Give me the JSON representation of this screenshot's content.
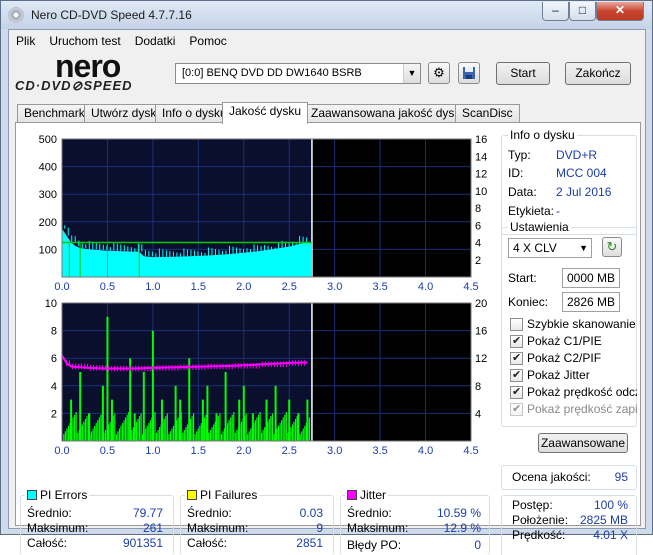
{
  "window": {
    "title": "Nero CD-DVD Speed 4.7.7.16",
    "min": "–",
    "max": "□",
    "close": "✕"
  },
  "menu": [
    "Plik",
    "Uruchom test",
    "Dodatki",
    "Pomoc"
  ],
  "logo": {
    "top": "nero",
    "bottom": "CD·DVD⊘SPEED"
  },
  "drive": {
    "value": "[0:0]   BENQ DVD DD DW1640 BSRB",
    "arrow": "▼"
  },
  "buttons": {
    "start": "Start",
    "stop": "Zakończ",
    "advanced": "Zaawansowane"
  },
  "tabs": [
    "Benchmark",
    "Utwórz dysk",
    "Info o dysku",
    "Jakość dysku",
    "Zaawansowana jakość dysku",
    "ScanDisc"
  ],
  "info": {
    "title": "Info o dysku",
    "type_label": "Typ:",
    "type": "DVD+R",
    "id_label": "ID:",
    "id": "MCC 004",
    "date_label": "Data:",
    "date": "2 Jul 2016",
    "label_label": "Etykieta:",
    "label": "-"
  },
  "settings": {
    "title": "Ustawienia",
    "speed": "4 X CLV",
    "start_label": "Start:",
    "start": "0000 MB",
    "end_label": "Koniec:",
    "end": "2826 MB",
    "checks": [
      {
        "label": "Szybkie skanowanie",
        "on": false,
        "dim": false
      },
      {
        "label": "Pokaż C1/PIE",
        "on": true,
        "dim": false
      },
      {
        "label": "Pokaż C2/PIF",
        "on": true,
        "dim": false
      },
      {
        "label": "Pokaż Jitter",
        "on": true,
        "dim": false
      },
      {
        "label": "Pokaż prędkość odczytu",
        "on": true,
        "dim": false
      },
      {
        "label": "Pokaż prędkość zapisu",
        "on": true,
        "dim": true
      }
    ]
  },
  "quality": {
    "label": "Ocena jakości:",
    "value": "95"
  },
  "progress": {
    "postep_label": "Postęp:",
    "postep": "100 %",
    "polozenie_label": "Położenie:",
    "polozenie": "2825 MB",
    "predkosc_label": "Prędkość:",
    "predkosc": "4.01 X"
  },
  "pi_errors": {
    "title": "PI Errors",
    "avg_label": "Średnio:",
    "avg": "79.77",
    "max_label": "Maksimum:",
    "max": "261",
    "total_label": "Całość:",
    "total": "901351",
    "color": "#00ffff"
  },
  "pi_failures": {
    "title": "PI Failures",
    "avg_label": "Średnio:",
    "avg": "0.03",
    "max_label": "Maksimum:",
    "max": "9",
    "total_label": "Całość:",
    "total": "2851",
    "color": "#ffff00"
  },
  "jitter": {
    "title": "Jitter",
    "avg_label": "Średnio:",
    "avg": "10.59 %",
    "max_label": "Maksimum:",
    "max": "12.9 %",
    "po_label": "Błędy PO:",
    "po": "0",
    "color": "#ff00ff"
  },
  "chart_data": [
    {
      "type": "area",
      "series": [
        {
          "name": "PI Errors",
          "color": "#00ffff",
          "x": [
            0.0,
            0.05,
            0.1,
            0.15,
            0.2,
            0.3,
            0.4,
            0.5,
            0.6,
            0.7,
            0.8,
            0.85,
            0.9,
            1.0,
            1.2,
            1.4,
            1.6,
            1.8,
            2.0,
            2.2,
            2.4,
            2.5,
            2.6,
            2.7,
            2.75
          ],
          "values": [
            175,
            150,
            125,
            112,
            105,
            100,
            98,
            95,
            94,
            93,
            92,
            92,
            75,
            72,
            73,
            75,
            78,
            82,
            88,
            95,
            105,
            110,
            118,
            128,
            120
          ]
        },
        {
          "name": "Read speed",
          "color": "#00cc00",
          "x": [
            0.0,
            0.5,
            1.0,
            1.5,
            2.0,
            2.5,
            2.75
          ],
          "values": [
            4,
            4,
            4,
            4,
            4,
            4,
            4
          ]
        }
      ],
      "xlim": [
        0,
        4.5
      ],
      "ylim": [
        0,
        500
      ],
      "y2lim": [
        0,
        16
      ],
      "xticks": [
        "0.0",
        "0.5",
        "1.0",
        "1.5",
        "2.0",
        "2.5",
        "3.0",
        "3.5",
        "4.0",
        "4.5"
      ],
      "yticks": [
        "100",
        "200",
        "300",
        "400",
        "500"
      ],
      "y2ticks": [
        "2",
        "4",
        "6",
        "8",
        "10",
        "12",
        "14",
        "16"
      ],
      "grid": true
    },
    {
      "type": "bar",
      "series": [
        {
          "name": "PI Failures",
          "color": "#00ff00",
          "x": [
            0.1,
            0.2,
            0.3,
            0.45,
            0.5,
            0.55,
            0.75,
            0.8,
            0.9,
            1.0,
            1.1,
            1.25,
            1.3,
            1.4,
            1.55,
            1.6,
            1.7,
            1.8,
            1.95,
            2.0,
            2.1,
            2.25,
            2.35,
            2.5,
            2.6,
            2.7
          ],
          "values": [
            3,
            5,
            2,
            4,
            9,
            3,
            6,
            2,
            5,
            8,
            3,
            4,
            3,
            6,
            3,
            4,
            2,
            5,
            3,
            4,
            2,
            3,
            4,
            3,
            2,
            3
          ]
        },
        {
          "name": "Jitter",
          "color": "#ff00ff",
          "x": [
            0.0,
            0.05,
            0.1,
            0.3,
            0.5,
            0.8,
            1.0,
            1.3,
            1.6,
            1.9,
            2.2,
            2.5,
            2.7
          ],
          "values": [
            12.4,
            11.3,
            10.8,
            10.6,
            10.5,
            10.5,
            10.6,
            10.7,
            10.8,
            10.9,
            11.1,
            11.3,
            11.4
          ]
        }
      ],
      "xlim": [
        0,
        4.5
      ],
      "ylim": [
        0,
        10
      ],
      "y2lim": [
        0,
        20
      ],
      "xticks": [
        "0.0",
        "0.5",
        "1.0",
        "1.5",
        "2.0",
        "2.5",
        "3.0",
        "3.5",
        "4.0",
        "4.5"
      ],
      "yticks": [
        "2",
        "4",
        "6",
        "8",
        "10"
      ],
      "y2ticks": [
        "4",
        "8",
        "12",
        "16",
        "20"
      ],
      "grid": true
    }
  ]
}
